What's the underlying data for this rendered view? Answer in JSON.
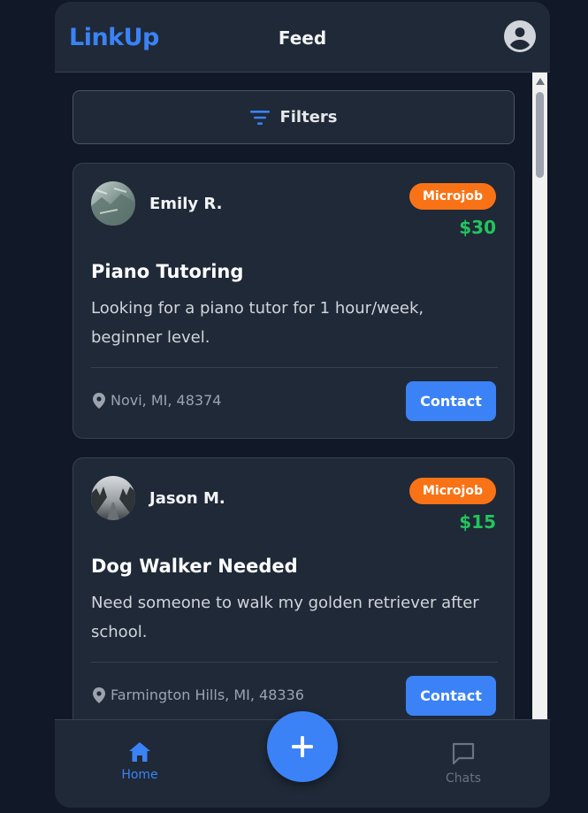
{
  "header": {
    "logo": "LinkUp",
    "title": "Feed",
    "profile_icon": "account-circle-icon"
  },
  "filters": {
    "label": "Filters",
    "icon": "filter-icon"
  },
  "posts": [
    {
      "user": "Emily R.",
      "badge": "Microjob",
      "price": "$30",
      "title": "Piano Tutoring",
      "description": "Looking for a piano tutor for 1 hour/week, beginner level.",
      "location": "Novi, MI, 48374",
      "action": "Contact"
    },
    {
      "user": "Jason M.",
      "badge": "Microjob",
      "price": "$15",
      "title": "Dog Walker Needed",
      "description": "Need someone to walk my golden retriever after school.",
      "location": "Farmington Hills, MI, 48336",
      "action": "Contact"
    }
  ],
  "nav": {
    "home_label": "Home",
    "chats_label": "Chats",
    "fab_icon": "plus-icon"
  },
  "colors": {
    "accent": "#3b82f6",
    "badge": "#f97316",
    "price": "#22c55e",
    "background": "#111827",
    "surface": "#1f2937"
  }
}
